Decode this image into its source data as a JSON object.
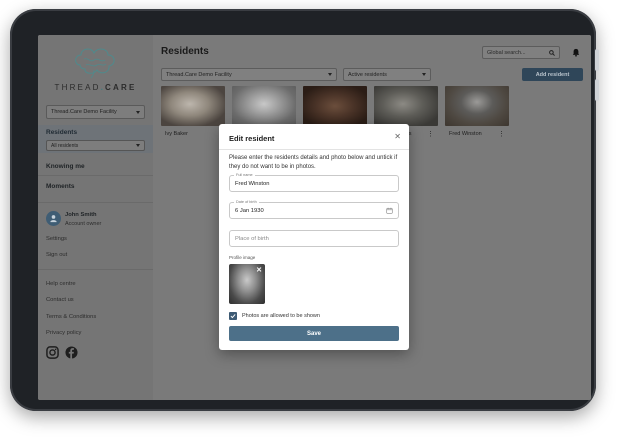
{
  "brand": {
    "name_part1": "THREAD",
    "name_dot": ".",
    "name_part2": "CARE"
  },
  "sidebar": {
    "facility_select": "Thread.Care Demo Facility",
    "residents_label": "Residents",
    "residents_select": "All residents",
    "nav": [
      "Knowing me",
      "Moments"
    ],
    "user": {
      "name": "John Smith",
      "role": "Account owner"
    },
    "settings_label": "Settings",
    "signout_label": "Sign out",
    "links": [
      "Help centre",
      "Contact us",
      "Terms & Conditions",
      "Privacy policy"
    ],
    "social_icons": [
      "instagram-icon",
      "facebook-icon"
    ]
  },
  "header": {
    "title": "Residents",
    "search_placeholder": "Global search..."
  },
  "filters": {
    "facility": "Thread.Care Demo Facility",
    "status": "Active residents",
    "add_button": "Add resident"
  },
  "residents": [
    {
      "name": "Ivy Baker"
    },
    {
      "name": ""
    },
    {
      "name": ""
    },
    {
      "name": "ys"
    },
    {
      "name": "Fred Winston"
    }
  ],
  "modal": {
    "title": "Edit resident",
    "description": "Please enter the residents details and photo below and untick if they do not want to be in photos.",
    "full_name_label": "Full name",
    "full_name_value": "Fred Winston",
    "dob_label": "Date of birth",
    "dob_value": "6 Jan 1930",
    "place_placeholder": "Place of birth",
    "profile_label": "Profile image",
    "photos_checkbox_label": "Photos are allowed to be shown",
    "photos_allowed": true,
    "save_label": "Save"
  },
  "colors": {
    "accent": "#4d7089",
    "button_dark": "#2f4659",
    "overlay": "#7a7a7a"
  }
}
